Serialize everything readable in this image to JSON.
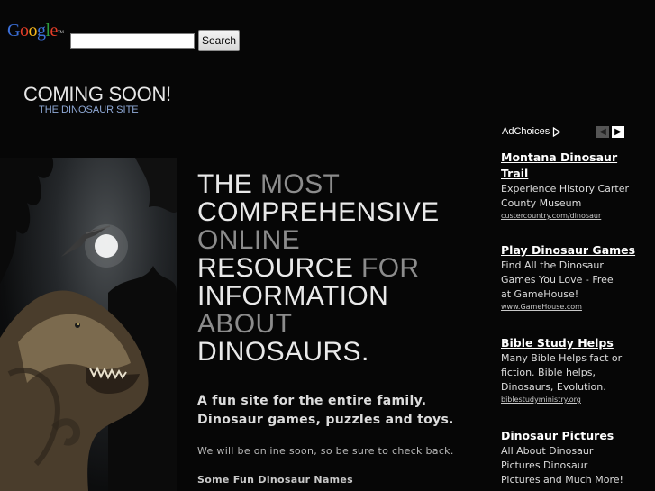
{
  "google": {
    "logo_letters": [
      "G",
      "o",
      "o",
      "g",
      "l",
      "e"
    ],
    "logo_tm": "TM",
    "search_value": "",
    "search_button": "Search"
  },
  "header": {
    "title": "COMING SOON!",
    "subtitle": "THE DINOSAUR SITE"
  },
  "headline": {
    "lines": [
      [
        {
          "text": "THE ",
          "tone": "white"
        },
        {
          "text": "MOST",
          "tone": "gray"
        }
      ],
      [
        {
          "text": "COMPREHENSIVE",
          "tone": "white"
        }
      ],
      [
        {
          "text": "ONLINE",
          "tone": "gray"
        }
      ],
      [
        {
          "text": "RESOURCE ",
          "tone": "white"
        },
        {
          "text": "FOR",
          "tone": "gray"
        }
      ],
      [
        {
          "text": "INFORMATION",
          "tone": "white"
        }
      ],
      [
        {
          "text": "ABOUT",
          "tone": "gray"
        }
      ],
      [
        {
          "text": "DINOSAURS.",
          "tone": "white"
        }
      ]
    ]
  },
  "tagline": {
    "line1": "A fun site for the entire family.",
    "line2": "Dinosaur games, puzzles and toys."
  },
  "check_back": "We will be online soon, so be sure to check back.",
  "fun_names_heading": "Some Fun Dinosaur Names",
  "adchoices": {
    "label": "AdChoices",
    "prev_icon": "chevron-left-icon",
    "next_icon": "chevron-right-icon"
  },
  "ads": [
    {
      "title": "Montana Dinosaur Trail",
      "title_lines": [
        "Montana Dinosaur",
        "Trail"
      ],
      "desc_lines": [
        "Experience History Carter",
        "County Museum"
      ],
      "url": "custercountry.com/dinosaur"
    },
    {
      "title": "Play Dinosaur Games",
      "title_lines": [
        "Play Dinosaur Games"
      ],
      "desc_lines": [
        "Find All the Dinosaur",
        "Games You Love - Free",
        "at GameHouse!"
      ],
      "url": "www.GameHouse.com"
    },
    {
      "title": "Bible Study Helps",
      "title_lines": [
        "Bible Study Helps"
      ],
      "desc_lines": [
        "Many Bible Helps fact or",
        "fiction. Bible helps,",
        "Dinosaurs, Evolution."
      ],
      "url": "biblestudyministry.org"
    },
    {
      "title": "Dinosaur Pictures",
      "title_lines": [
        "Dinosaur Pictures"
      ],
      "desc_lines": [
        "All About Dinosaur",
        "Pictures Dinosaur",
        "Pictures and Much More!"
      ],
      "url": ""
    }
  ],
  "colors": {
    "background": "#060606",
    "headline_white": "#e9e9e9",
    "headline_gray": "#8c8c8c",
    "subtitle_blue": "#8fa9d6"
  }
}
